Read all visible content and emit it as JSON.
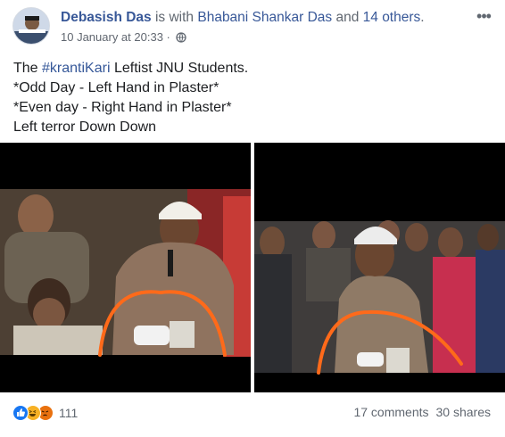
{
  "post": {
    "author": "Debasish Das",
    "with_text": " is with ",
    "tagged_person": "Bhabani Shankar Das",
    "and_text": " and ",
    "others": "14 others",
    "period": ".",
    "timestamp": "10 January at 20:33",
    "separator": " · ",
    "privacy_icon": "globe-icon",
    "more_icon": "more-options-icon",
    "text_prefix": "The ",
    "hashtag": "#krantiKari",
    "text_line1_rest": " Leftist JNU Students.",
    "text_line2": "*Odd Day - Left Hand in Plaster*",
    "text_line3": "*Even day - Right Hand in Plaster*",
    "text_line4": "Left terror Down Down"
  },
  "photos": [
    {
      "subject": "student-with-microphone",
      "annotation_color": "#ff6a1a"
    },
    {
      "subject": "student-in-crowd",
      "annotation_color": "#ff6a1a"
    }
  ],
  "footer": {
    "reactions": [
      "like",
      "haha",
      "angry"
    ],
    "reaction_count": "111",
    "comments": "17 comments",
    "shares": "30 shares"
  },
  "colors": {
    "link": "#385898",
    "secondary": "#606770",
    "like": "#1877f2",
    "haha": "#f7b125",
    "angry": "#e9710f"
  }
}
